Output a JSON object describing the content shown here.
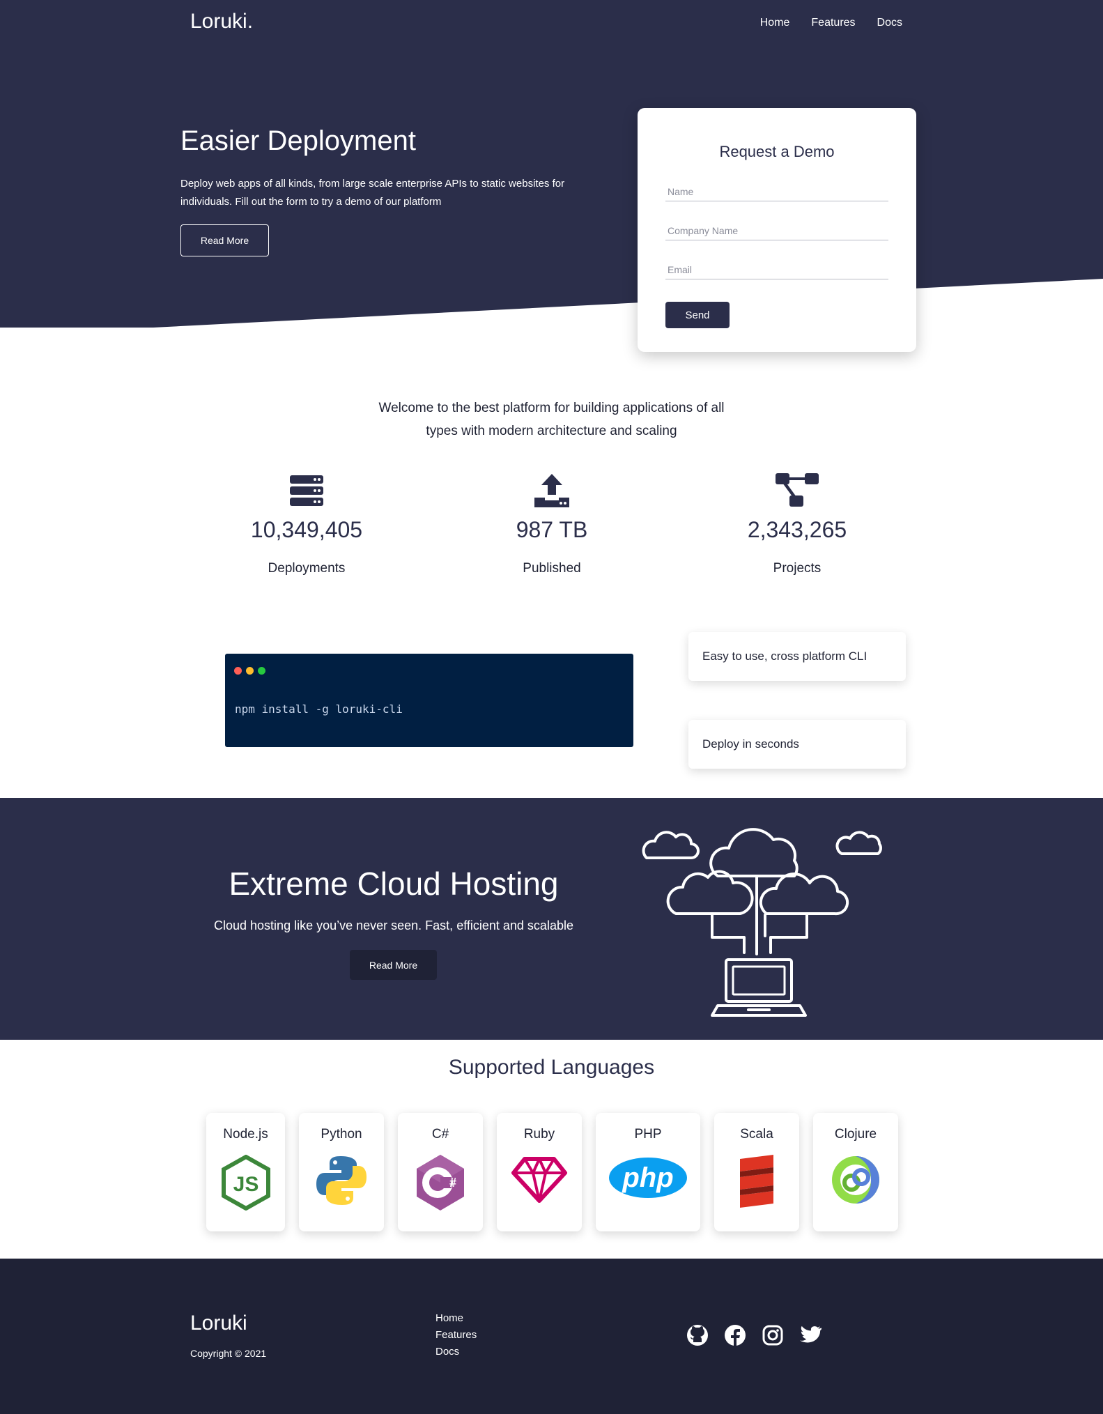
{
  "header": {
    "brand": "Loruki.",
    "nav": [
      "Home",
      "Features",
      "Docs"
    ]
  },
  "hero": {
    "title": "Easier Deployment",
    "text": "Deploy web apps of all kinds, from large scale enterprise APIs to static websites for individuals. Fill out the form to try a demo of our platform",
    "button": "Read More"
  },
  "demo_form": {
    "title": "Request a Demo",
    "name_placeholder": "Name",
    "company_placeholder": "Company Name",
    "email_placeholder": "Email",
    "send_label": "Send"
  },
  "welcome": {
    "text": "Welcome to the best platform for building applications of all types with modern architecture and scaling"
  },
  "stats": [
    {
      "icon": "server-icon",
      "value": "10,349,405",
      "label": "Deployments"
    },
    {
      "icon": "upload-icon",
      "value": "987 TB",
      "label": "Published"
    },
    {
      "icon": "project-diagram-icon",
      "value": "2,343,265",
      "label": "Projects"
    }
  ],
  "cli": {
    "command": "npm install -g loruki-cli",
    "dot_colors": [
      "#ff5f56",
      "#ffbd2e",
      "#27c93f"
    ],
    "features": [
      "Easy to use, cross platform CLI",
      "Deploy in seconds"
    ]
  },
  "cloud": {
    "title": "Extreme Cloud Hosting",
    "text": "Cloud hosting like you’ve never seen. Fast, efficient and scalable",
    "button": "Read More",
    "illustration": "cloud-network-laptop-icon"
  },
  "languages": {
    "title": "Supported Languages",
    "items": [
      {
        "name": "Node.js",
        "icon": "nodejs-icon"
      },
      {
        "name": "Python",
        "icon": "python-icon"
      },
      {
        "name": "C#",
        "icon": "csharp-icon"
      },
      {
        "name": "Ruby",
        "icon": "ruby-icon"
      },
      {
        "name": "PHP",
        "icon": "php-icon"
      },
      {
        "name": "Scala",
        "icon": "scala-icon"
      },
      {
        "name": "Clojure",
        "icon": "clojure-icon"
      }
    ]
  },
  "footer": {
    "brand": "Loruki",
    "copyright": "Copyright © 2021",
    "links": [
      "Home",
      "Features",
      "Docs"
    ],
    "socials": [
      "github-icon",
      "facebook-icon",
      "instagram-icon",
      "twitter-icon"
    ]
  },
  "colors": {
    "primary": "#2b2e4a",
    "footer": "#1f2236",
    "terminal": "#011f42"
  }
}
